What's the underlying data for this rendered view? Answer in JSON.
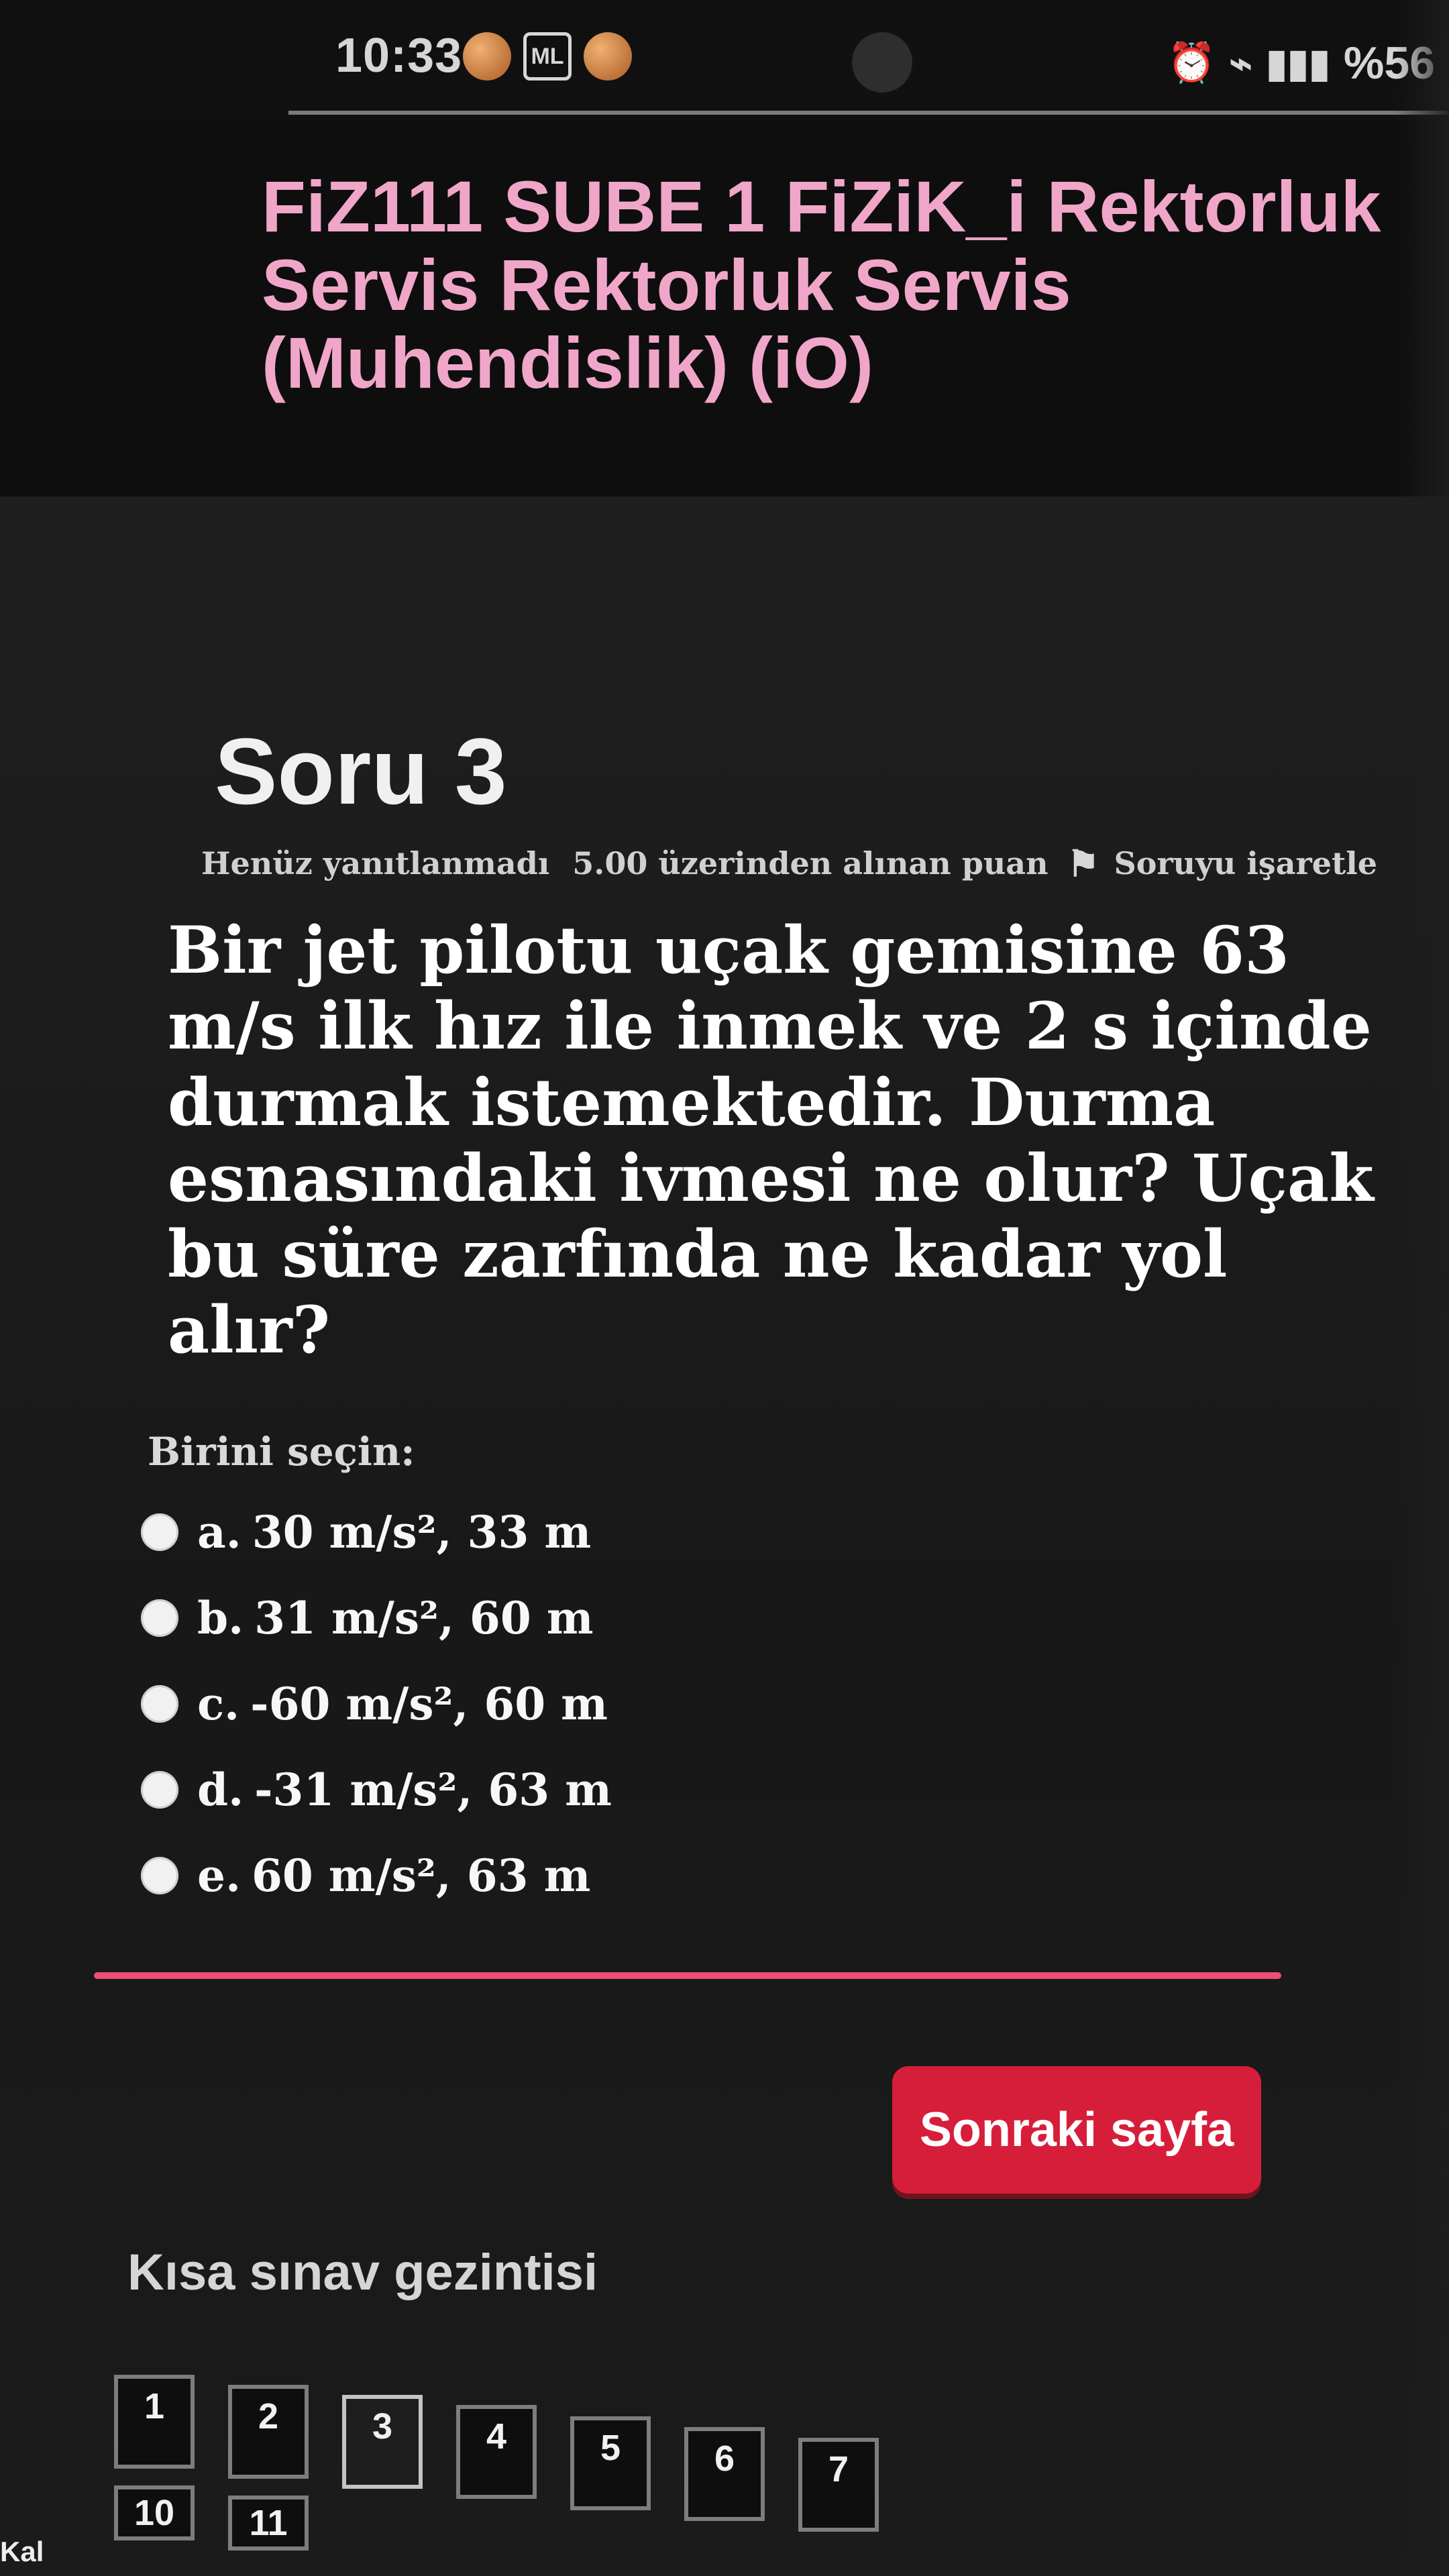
{
  "status_bar": {
    "time": "10:33",
    "notification_box": "ML",
    "battery": "%56"
  },
  "header": {
    "course_title": "FiZ111 SUBE 1 FiZiK_i Rektorluk Servis Rektorluk Servis (Muhendislik) (iO)"
  },
  "question": {
    "title": "Soru 3",
    "status": "Henüz yanıtlanmadı",
    "grade": "5.00 üzerinden alınan puan",
    "flag_label": "Soruyu işaretle",
    "text": "Bir jet pilotu uçak gemisine 63 m/s ilk hız ile inmek ve 2 s içinde durmak istemektedir. Durma esnasındaki ivmesi ne olur? Uçak bu süre zarfında ne kadar yol alır?",
    "prompt": "Birini seçin:",
    "options": [
      {
        "letter": "a.",
        "value": "30 m/s², 33 m"
      },
      {
        "letter": "b.",
        "value": "31 m/s², 60 m"
      },
      {
        "letter": "c.",
        "value": "-60 m/s², 60 m"
      },
      {
        "letter": "d.",
        "value": "-31 m/s², 63 m"
      },
      {
        "letter": "e.",
        "value": "60 m/s², 63 m"
      }
    ]
  },
  "actions": {
    "next_page": "Sonraki sayfa"
  },
  "navigation": {
    "title": "Kısa sınav gezintisi",
    "items": [
      "1",
      "2",
      "3",
      "4",
      "5",
      "6",
      "7",
      "10",
      "11"
    ]
  },
  "footer": {
    "partial_label": "Kal"
  }
}
